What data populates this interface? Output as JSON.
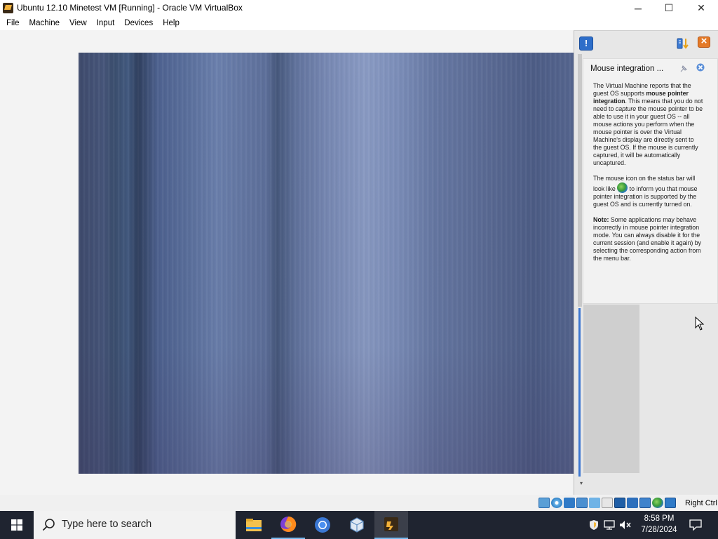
{
  "window": {
    "title": "Ubuntu 12.10 Minetest VM [Running] - Oracle VM VirtualBox",
    "controls": {
      "minimize": "─",
      "maximize": "☐",
      "close": "✕"
    }
  },
  "menubar": {
    "items": [
      "File",
      "Machine",
      "View",
      "Input",
      "Devices",
      "Help"
    ]
  },
  "notification_center": {
    "icons": {
      "info": "info-icon",
      "sort": "sort-icon",
      "close_all": "close-all-icon"
    },
    "card": {
      "title": "Mouse integration ...",
      "pin_icon": "pin-icon",
      "close_icon": "close-icon",
      "p1_a": "The Virtual Machine reports that the guest OS supports ",
      "p1_b": "mouse pointer integration",
      "p1_c": ". This means that you do not need to ",
      "p1_d": "capture",
      "p1_e": " the mouse pointer to be able to use it in your guest OS -- all mouse actions you perform when the mouse pointer is over the Virtual Machine's display are directly sent to the guest OS. If the mouse is currently captured, it will be automatically uncaptured.",
      "p2_a": "The mouse icon on the status bar will look like ",
      "p2_b": " to inform you that mouse pointer integration is supported by the guest OS and is currently turned on.",
      "p3_a": "Note:",
      "p3_b": " Some applications may behave incorrectly in mouse pointer integration mode. You can always disable it for the current session (and enable it again) by selecting the corresponding action from the menu bar."
    }
  },
  "statusbar": {
    "icons": [
      "hard-disk-icon",
      "optical-drive-icon",
      "audio-icon",
      "network-icon",
      "usb-icon",
      "shared-folders-icon",
      "display-icon",
      "video-capture-icon",
      "cpu-icon",
      "mouse-integration-icon",
      "keyboard-icon"
    ],
    "host_key": "Right Ctrl"
  },
  "taskbar": {
    "search_placeholder": "Type here to search",
    "apps": [
      "file-explorer-icon",
      "firefox-icon",
      "chromium-icon",
      "virtualbox-icon",
      "virtualbox-vm-icon"
    ],
    "time": "8:58 PM",
    "date": "7/28/2024"
  }
}
